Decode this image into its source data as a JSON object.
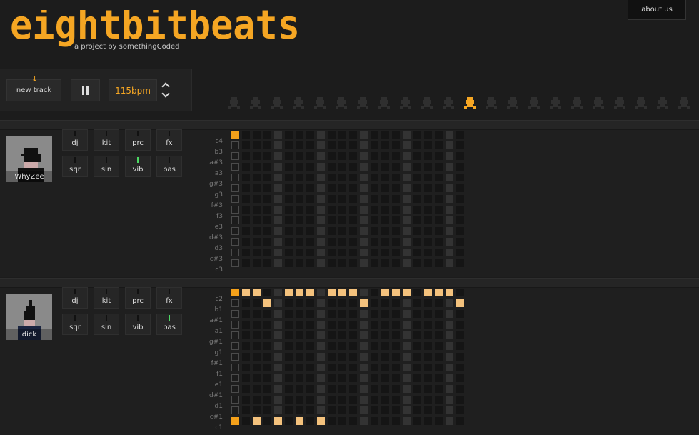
{
  "app": {
    "logo_text": "eightbitbeats",
    "tagline": "a project by somethingCoded",
    "about_label": "about us",
    "accent": "#f5a623"
  },
  "controls": {
    "new_track_label": "new track",
    "bpm_label": "115bpm",
    "pause_icon": "pause-icon",
    "stepper_icon": "up-down-chevron-icon"
  },
  "columns": 22,
  "tracks": [
    {
      "user": "WhyZee",
      "instruments": [
        {
          "label": "dj",
          "active": false
        },
        {
          "label": "kit",
          "active": false
        },
        {
          "label": "prc",
          "active": false
        },
        {
          "label": "fx",
          "active": false
        },
        {
          "label": "sqr",
          "active": false
        },
        {
          "label": "sin",
          "active": false
        },
        {
          "label": "vib",
          "active": true
        },
        {
          "label": "bas",
          "active": false
        }
      ],
      "notes": [
        "c4",
        "b3",
        "a#3",
        "a3",
        "g#3",
        "g3",
        "f#3",
        "f3",
        "e3",
        "d#3",
        "d3",
        "c#3",
        "c3"
      ],
      "active_steps": [],
      "playhead_step": 0,
      "playhead_rows": [
        0
      ]
    },
    {
      "user": "dick",
      "instruments": [
        {
          "label": "dj",
          "active": false
        },
        {
          "label": "kit",
          "active": false
        },
        {
          "label": "prc",
          "active": false
        },
        {
          "label": "fx",
          "active": false
        },
        {
          "label": "sqr",
          "active": false
        },
        {
          "label": "sin",
          "active": false
        },
        {
          "label": "vib",
          "active": false
        },
        {
          "label": "bas",
          "active": true
        }
      ],
      "notes": [
        "c2",
        "b1",
        "a#1",
        "a1",
        "g#1",
        "g1",
        "f#1",
        "f1",
        "e1",
        "d#1",
        "d1",
        "c#1",
        "c1"
      ],
      "active_steps": [
        [
          0,
          1
        ],
        [
          0,
          2
        ],
        [
          0,
          5
        ],
        [
          0,
          6
        ],
        [
          0,
          7
        ],
        [
          0,
          9
        ],
        [
          0,
          10
        ],
        [
          0,
          11
        ],
        [
          0,
          14
        ],
        [
          0,
          15
        ],
        [
          0,
          16
        ],
        [
          0,
          18
        ],
        [
          0,
          19
        ],
        [
          0,
          20
        ],
        [
          1,
          3
        ],
        [
          1,
          12
        ],
        [
          1,
          21
        ],
        [
          12,
          2
        ],
        [
          12,
          4
        ],
        [
          12,
          6
        ],
        [
          12,
          8
        ]
      ],
      "playhead_step": 0,
      "playhead_rows": [
        0,
        12
      ]
    }
  ]
}
